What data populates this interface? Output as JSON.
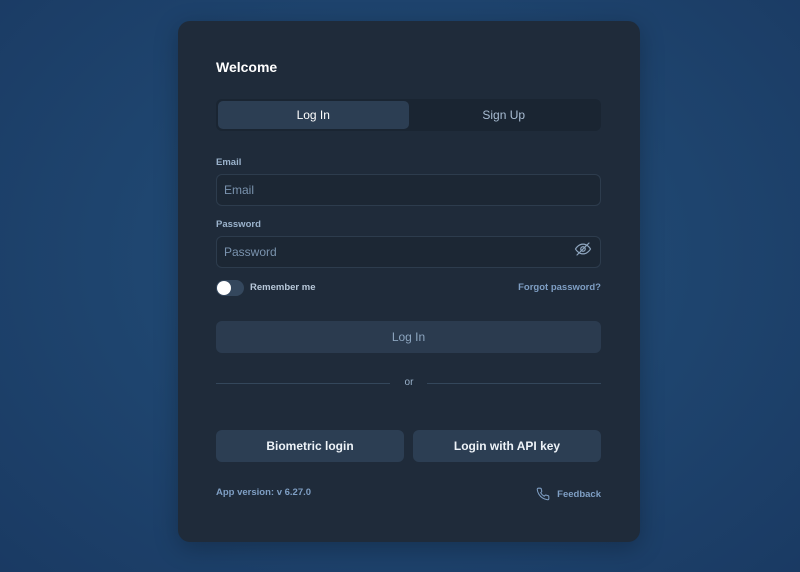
{
  "card": {
    "title": "Welcome"
  },
  "tabs": [
    {
      "label": "Log In",
      "active": true
    },
    {
      "label": "Sign Up",
      "active": false
    }
  ],
  "form": {
    "email_label": "Email",
    "email_placeholder": "Email",
    "email_value": "",
    "password_label": "Password",
    "password_placeholder": "Password",
    "password_value": "",
    "password_toggle_icon": "eye-off-icon",
    "remember_label": "Remember me",
    "remember_on": false,
    "forgot_label": "Forgot password?",
    "submit_label": "Log In"
  },
  "divider": {
    "label": "or"
  },
  "alt_login": {
    "biometric_label": "Biometric login",
    "api_key_label": "Login with API key"
  },
  "footer": {
    "version": "App version: v 6.27.0",
    "feedback_label": "Feedback",
    "feedback_icon": "phone-icon"
  },
  "colors": {
    "background": "#1f4670",
    "card": "#1f2b3a",
    "accent_link": "#7f9fc4",
    "button": "#2c3e53"
  }
}
